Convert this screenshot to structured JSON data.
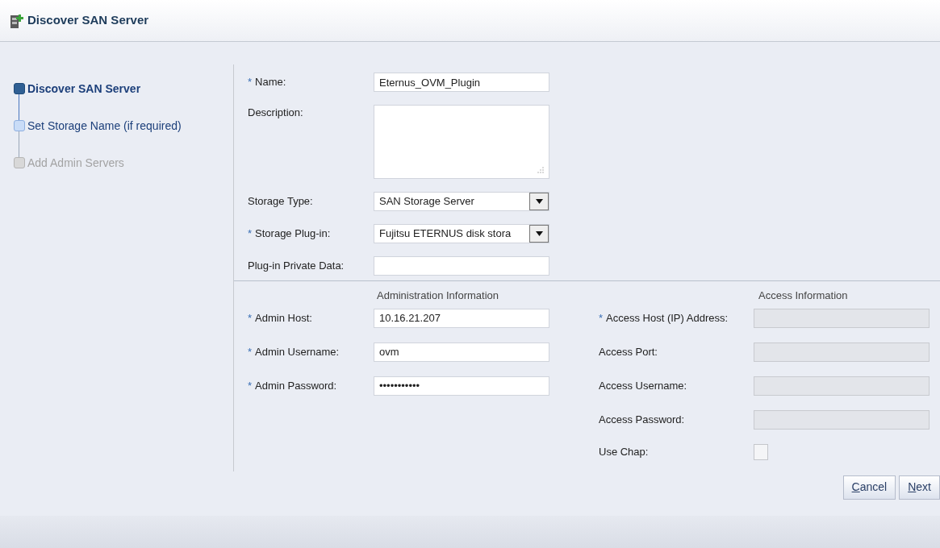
{
  "window": {
    "title": "Discover SAN Server"
  },
  "steps": [
    {
      "label": "Discover SAN Server",
      "selected": true,
      "disabled": false
    },
    {
      "label": "Set Storage Name (if required)",
      "selected": false,
      "disabled": false
    },
    {
      "label": "Add Admin Servers",
      "selected": false,
      "disabled": true
    }
  ],
  "general": [
    {
      "kind": "text",
      "marker": "*",
      "label": "Name:",
      "value": "Eternus_OVM_Plugin"
    },
    {
      "kind": "textarea",
      "label": "Description:"
    },
    {
      "kind": "select",
      "label": "Storage Type:",
      "value": "SAN Storage Server"
    },
    {
      "kind": "select",
      "marker": "*",
      "label": "Storage Plug-in:",
      "value": "Fujitsu ETERNUS disk stora"
    },
    {
      "kind": "text",
      "label": "Plug-in Private Data:"
    }
  ],
  "admin": {
    "heading": "Administration Information",
    "fields": [
      {
        "kind": "text",
        "marker": "*",
        "label": "Admin Host:",
        "value": "10.16.21.207",
        "disabled": false
      },
      {
        "kind": "text",
        "marker": "*",
        "label": "Admin Username:",
        "value": "ovm",
        "disabled": false
      },
      {
        "kind": "text",
        "marker": "*",
        "label": "Admin Password:",
        "value": "•••••••••••",
        "disabled": false
      }
    ]
  },
  "access": {
    "heading": "Access Information",
    "fields": [
      {
        "kind": "text",
        "marker": "*",
        "label": "Access Host (IP) Address:",
        "disabled": true
      },
      {
        "kind": "text",
        "label": "Access Port:",
        "disabled": true
      },
      {
        "kind": "text",
        "label": "Access Username:",
        "disabled": true
      },
      {
        "kind": "text",
        "label": "Access Password:",
        "disabled": true
      },
      {
        "kind": "checkbox",
        "label": "Use Chap:",
        "checked": false
      }
    ]
  },
  "buttons": [
    {
      "mnemonic": "C",
      "rest": "ancel"
    },
    {
      "mnemonic": "N",
      "rest": "ext"
    }
  ]
}
